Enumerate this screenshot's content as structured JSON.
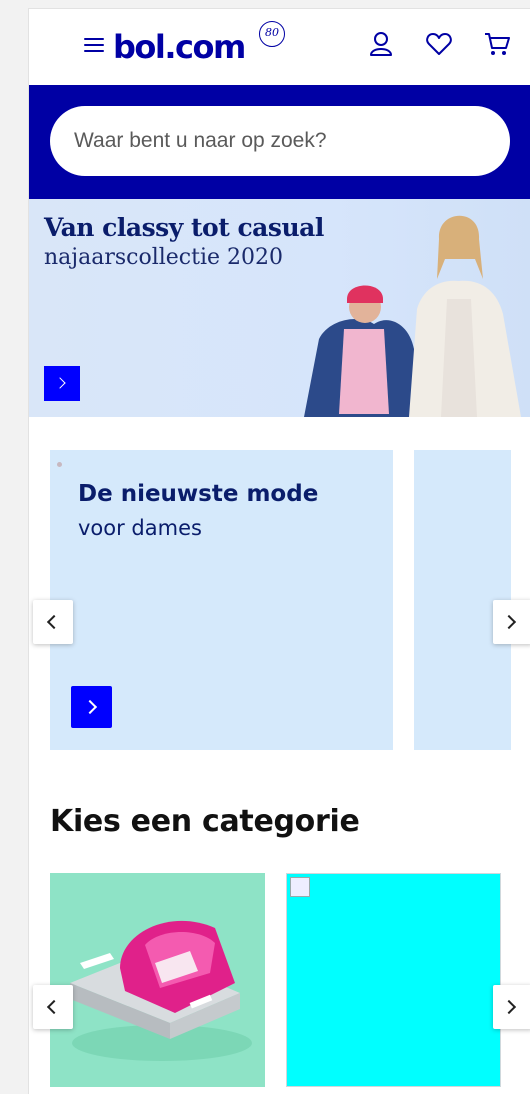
{
  "header": {
    "logo_text": "bol.com",
    "logo_badge": "80",
    "brand_color": "#0000a4",
    "icons": [
      "menu-icon",
      "user-icon",
      "heart-icon",
      "cart-icon"
    ]
  },
  "search": {
    "placeholder": "Waar bent u naar op zoek?"
  },
  "hero": {
    "title": "Van classy tot casual",
    "subtitle": "najaarscollectie 2020",
    "cta_icon": "chevron-right-icon"
  },
  "promo": {
    "title": "De nieuwste mode",
    "subtitle": "voor dames",
    "cta_icon": "chevron-right-icon"
  },
  "category": {
    "heading": "Kies een categorie",
    "tile_colors": [
      "#8ee3c6",
      "#00ffff"
    ]
  }
}
